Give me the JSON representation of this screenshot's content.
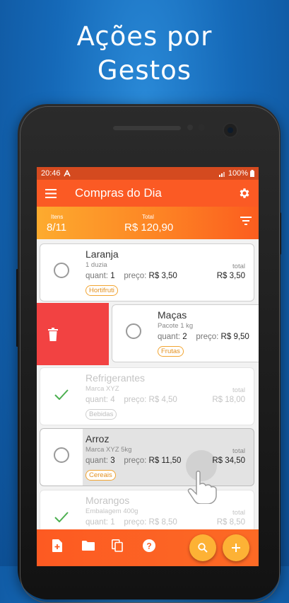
{
  "promo": {
    "line1": "Ações por",
    "line2": "Gestos"
  },
  "status": {
    "time": "20:46",
    "battery": "100%"
  },
  "appbar": {
    "title": "Compras do Dia",
    "menu_icon": "menu-icon",
    "settings_icon": "gear-icon"
  },
  "summary": {
    "items_label": "Itens",
    "items_value": "8/11",
    "total_label": "Total",
    "total_value": "R$ 120,90",
    "filter_icon": "filter-icon"
  },
  "labels": {
    "quant": "quant:",
    "preco": "preço:",
    "total": "total"
  },
  "items": [
    {
      "name": "Laranja",
      "desc": "1 duzia",
      "quant": "1",
      "preco": "R$ 3,50",
      "total": "R$ 3,50",
      "category": "Hortifruti",
      "checked": false
    },
    {
      "name": "Maças",
      "desc": "Pacote 1 kg",
      "quant": "2",
      "preco": "R$ 9,50",
      "category": "Frutas",
      "checked": false
    },
    {
      "name": "Refrigerantes",
      "desc": "Marca XYZ",
      "quant": "4",
      "preco": "R$ 4,50",
      "total": "R$ 18,00",
      "category": "Bebidas",
      "checked": true
    },
    {
      "name": "Arroz",
      "desc": "Marca XYZ 5kg",
      "quant": "3",
      "preco": "R$ 11,50",
      "total": "R$ 34,50",
      "category": "Cereais",
      "checked": false
    },
    {
      "name": "Morangos",
      "desc": "Embalagem 400g",
      "quant": "1",
      "preco": "R$ 8,50",
      "total": "R$ 8,50",
      "checked": true
    }
  ],
  "bottom_bar": {
    "icons": [
      "add-file-icon",
      "folder-icon",
      "copy-icon",
      "help-icon"
    ],
    "fabs": [
      "search-icon",
      "add-icon"
    ]
  },
  "colors": {
    "primary": "#fb5a24",
    "accent": "#fdb235",
    "delete": "#f24242",
    "check": "#4caf50",
    "background": "#1569b8"
  }
}
